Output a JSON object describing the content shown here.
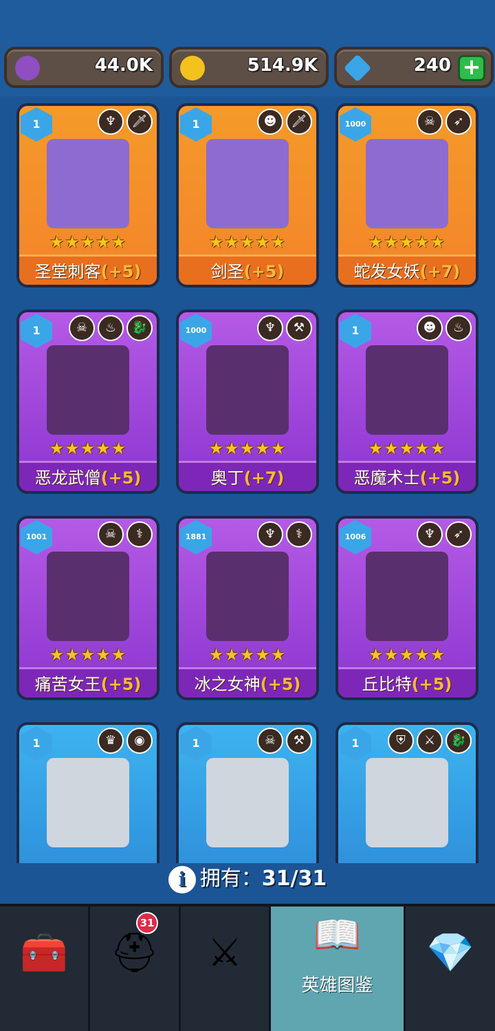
{
  "currencies": [
    {
      "name": "purple-coin",
      "value": "44.0K",
      "color": "#8e4fc2"
    },
    {
      "name": "gold-coin",
      "value": "514.9K",
      "color": "#f4c21c"
    },
    {
      "name": "gem",
      "value": "240",
      "color": "#3aa6e8"
    }
  ],
  "add_label": "+",
  "heroes": [
    {
      "name": "圣堂刺客",
      "bonus": "(+5)",
      "level": "1",
      "rarity": "orange",
      "tags": [
        "wings-emblem-icon",
        "dagger-icon"
      ],
      "stars": "★★★★★"
    },
    {
      "name": "剑圣",
      "bonus": "(+5)",
      "level": "1",
      "rarity": "orange",
      "tags": [
        "helmet-emblem-icon",
        "dagger-icon"
      ],
      "stars": "★★★★★"
    },
    {
      "name": "蛇发女妖",
      "bonus": "(+7)",
      "level": "1000",
      "rarity": "orange",
      "tags": [
        "skull-icon",
        "bow-icon"
      ],
      "stars": "★★★★★"
    },
    {
      "name": "恶龙武僧",
      "bonus": "(+5)",
      "level": "1",
      "rarity": "purple",
      "tags": [
        "skull-icon",
        "flame-icon",
        "dragon-icon"
      ],
      "stars": "★★★★★"
    },
    {
      "name": "奥丁",
      "bonus": "(+7)",
      "level": "1000",
      "rarity": "purple",
      "tags": [
        "wings-emblem-icon",
        "hammer-icon"
      ],
      "stars": "★★★★★"
    },
    {
      "name": "恶魔术士",
      "bonus": "(+5)",
      "level": "1",
      "rarity": "purple",
      "tags": [
        "helmet-emblem-icon",
        "flame-icon"
      ],
      "stars": "★★★★★"
    },
    {
      "name": "痛苦女王",
      "bonus": "(+5)",
      "level": "1001",
      "rarity": "purple",
      "tags": [
        "skull-icon",
        "staff-icon"
      ],
      "stars": "★★★★★"
    },
    {
      "name": "冰之女神",
      "bonus": "(+5)",
      "level": "1881",
      "rarity": "purple",
      "tags": [
        "wings-emblem-icon",
        "staff-icon"
      ],
      "stars": "★★★★★"
    },
    {
      "name": "丘比特",
      "bonus": "(+5)",
      "level": "1006",
      "rarity": "purple",
      "tags": [
        "wings-emblem-icon",
        "bow-icon"
      ],
      "stars": "★★★★★"
    },
    {
      "name": "",
      "bonus": "",
      "level": "1",
      "rarity": "blue",
      "tags": [
        "elf-icon",
        "eye-icon"
      ],
      "stars": ""
    },
    {
      "name": "",
      "bonus": "",
      "level": "1",
      "rarity": "blue",
      "tags": [
        "skull-icon",
        "hammer-icon"
      ],
      "stars": ""
    },
    {
      "name": "",
      "bonus": "",
      "level": "1",
      "rarity": "blue",
      "tags": [
        "knight-helmet-icon",
        "sword-icon",
        "dragon-icon"
      ],
      "stars": ""
    }
  ],
  "owned": {
    "label": "拥有：",
    "count": "31/31"
  },
  "nav": {
    "items": [
      {
        "name": "chest",
        "label": ""
      },
      {
        "name": "heroes",
        "label": "",
        "badge": "31"
      },
      {
        "name": "battle",
        "label": ""
      },
      {
        "name": "codex",
        "label": "英雄图鉴"
      },
      {
        "name": "amulet",
        "label": ""
      }
    ]
  },
  "colors": {
    "background": "#1b5596",
    "orange_card": "#f3842a",
    "purple_card": "#8c36d0",
    "blue_card": "#2b88d6",
    "bonus_text": "#ffb83a",
    "active_tab": "#5fa6b0"
  }
}
